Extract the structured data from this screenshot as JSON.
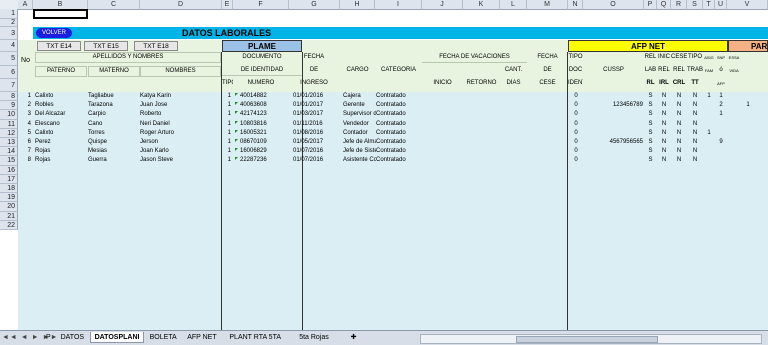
{
  "columns": [
    "A",
    "B",
    "C",
    "D",
    "E",
    "F",
    "G",
    "H",
    "I",
    "J",
    "K",
    "L",
    "M",
    "N",
    "O",
    "P",
    "Q",
    "R",
    "S",
    "T",
    "U",
    "V"
  ],
  "rows": [
    "1",
    "2",
    "3",
    "4",
    "5",
    "6",
    "7",
    "8",
    "9",
    "10",
    "11",
    "12",
    "13",
    "14",
    "15",
    "16",
    "17",
    "18",
    "19",
    "20",
    "21",
    "22"
  ],
  "title": "DATOS LABORALES",
  "volver": "VOLVER",
  "txt_buttons": [
    "TXT E14",
    "TXT E15",
    "TXT E18"
  ],
  "sections": {
    "plame": "PLAME",
    "afpnet": "AFP NET",
    "para": "PARA"
  },
  "headers": {
    "no": "No",
    "apellidos": "APELLIDOS Y NOMBRES",
    "paterno": "PATERNO",
    "materno": "MATERNO",
    "nombres": "NOMBRES",
    "documento": "DOCUMENTO",
    "de_identidad": "DE IDENTIDAD",
    "tipo": "TIPO",
    "numero": "NÚMERO",
    "fecha": "FECHA",
    "de": "DE",
    "ingreso": "INGRESO",
    "cargo": "CARGO",
    "categoria": "CATEGORÍA",
    "fecha_vac": "FECHA DE VACACIONES",
    "inicio": "INICIO",
    "retorno": "RETORNO",
    "cant": "CANT.",
    "dias": "DÍAS",
    "fecha2": "FECHA",
    "de2": "DE",
    "cese": "CESE",
    "tipo_doc": "TIPO",
    "doc": "DOC",
    "ident": "IDENT",
    "cussp": "CUSSP",
    "rel": "REL",
    "lab": "LAB",
    "rl": "RL",
    "inic": "INIC",
    "rel2": "REL",
    "irl": "IRL",
    "cese2": "CESE",
    "rel3": "REL",
    "crl": "CRL",
    "tipo_trab": "TIPO",
    "trab": "TRAB",
    "tt": "TT",
    "asig": "ASIG",
    "fam": "FAM",
    "snp": "SNP",
    "o": "ó",
    "afp": "AFP",
    "essa": "ESSA",
    "vida": "VIDA"
  },
  "employees": [
    {
      "n": "1",
      "paterno": "Calixto",
      "materno": "Tagliabue",
      "nombres": "Katya Karin",
      "tipo": "1",
      "numero": "40014882",
      "fecha": "01/01/2016",
      "cargo": "Cajera",
      "categoria": "Contratado",
      "doc": "0",
      "cussp": "",
      "rl": "S",
      "irl": "N",
      "crl": "N",
      "tt": "N",
      "fam": "1",
      "snp": "1",
      "vida": ""
    },
    {
      "n": "2",
      "paterno": "Robles",
      "materno": "Tarazona",
      "nombres": "Juan Jose",
      "tipo": "1",
      "numero": "40063608",
      "fecha": "01/01/2017",
      "cargo": "Gerente",
      "categoria": "Contratado",
      "doc": "0",
      "cussp": "123456789",
      "rl": "S",
      "irl": "N",
      "crl": "N",
      "tt": "N",
      "fam": "",
      "snp": "2",
      "vida": "1"
    },
    {
      "n": "3",
      "paterno": "Del Alcazar",
      "materno": "Carpio",
      "nombres": "Roberto",
      "tipo": "1",
      "numero": "42174123",
      "fecha": "01/03/2017",
      "cargo": "Supervisor de",
      "categoria": "Contratado",
      "doc": "0",
      "cussp": "",
      "rl": "S",
      "irl": "N",
      "crl": "N",
      "tt": "N",
      "fam": "",
      "snp": "1",
      "vida": ""
    },
    {
      "n": "4",
      "paterno": "Elescano",
      "materno": "Cano",
      "nombres": "Neri Daniel",
      "tipo": "1",
      "numero": "10803816",
      "fecha": "01/11/2016",
      "cargo": "Vendedor",
      "categoria": "Contratado",
      "doc": "0",
      "cussp": "",
      "rl": "S",
      "irl": "N",
      "crl": "N",
      "tt": "N",
      "fam": "",
      "snp": "",
      "vida": ""
    },
    {
      "n": "5",
      "paterno": "Calixto",
      "materno": "Torres",
      "nombres": "Roger Arturo",
      "tipo": "1",
      "numero": "16005321",
      "fecha": "01/08/2016",
      "cargo": "Contador",
      "categoria": "Contratado",
      "doc": "0",
      "cussp": "",
      "rl": "S",
      "irl": "N",
      "crl": "N",
      "tt": "N",
      "fam": "1",
      "snp": "",
      "vida": ""
    },
    {
      "n": "6",
      "paterno": "Perez",
      "materno": "Quispe",
      "nombres": "Jerson",
      "tipo": "1",
      "numero": "08670109",
      "fecha": "01/05/2017",
      "cargo": "Jefe de Almace",
      "categoria": "Contratado",
      "doc": "0",
      "cussp": "4567956565",
      "rl": "S",
      "irl": "N",
      "crl": "N",
      "tt": "N",
      "fam": "",
      "snp": "9",
      "vida": ""
    },
    {
      "n": "7",
      "paterno": "Rojas",
      "materno": "Mesias",
      "nombres": "Joan Karlo",
      "tipo": "1",
      "numero": "16006829",
      "fecha": "01/07/2016",
      "cargo": "Jefe de Sistem",
      "categoria": "Contratado",
      "doc": "0",
      "cussp": "",
      "rl": "S",
      "irl": "N",
      "crl": "N",
      "tt": "N",
      "fam": "",
      "snp": "",
      "vida": ""
    },
    {
      "n": "8",
      "paterno": "Rojas",
      "materno": "Guerra",
      "nombres": "Jason Steve",
      "tipo": "1",
      "numero": "22287236",
      "fecha": "01/07/2016",
      "cargo": "Asistente Cont",
      "categoria": "Contratado",
      "doc": "0",
      "cussp": "",
      "rl": "S",
      "irl": "N",
      "crl": "N",
      "tt": "N",
      "fam": "",
      "snp": "",
      "vida": ""
    }
  ],
  "empty_row_numbers": [
    "9",
    "10",
    "11",
    "12",
    "13",
    "14",
    "15",
    "16",
    "17",
    "18",
    "19",
    "20",
    "21",
    "22"
  ],
  "tabs": [
    "P",
    "DATOS",
    "DATOSPLANI",
    "BOLETA",
    "AFP NET",
    "PLANT RTA 5TA",
    "5ta Rojas"
  ],
  "active_tab": "DATOSPLANI",
  "nav_arrows": "◄◄ ◄ ► ►►",
  "colors": {
    "datos_bar": "#00b4e8",
    "volver": "#1b1ee0",
    "plame": "#9bc2e6",
    "afpnet": "#ffff00",
    "para": "#f4b183",
    "grid_green": "#e8f4e0",
    "grid_blue": "#daeef3"
  }
}
